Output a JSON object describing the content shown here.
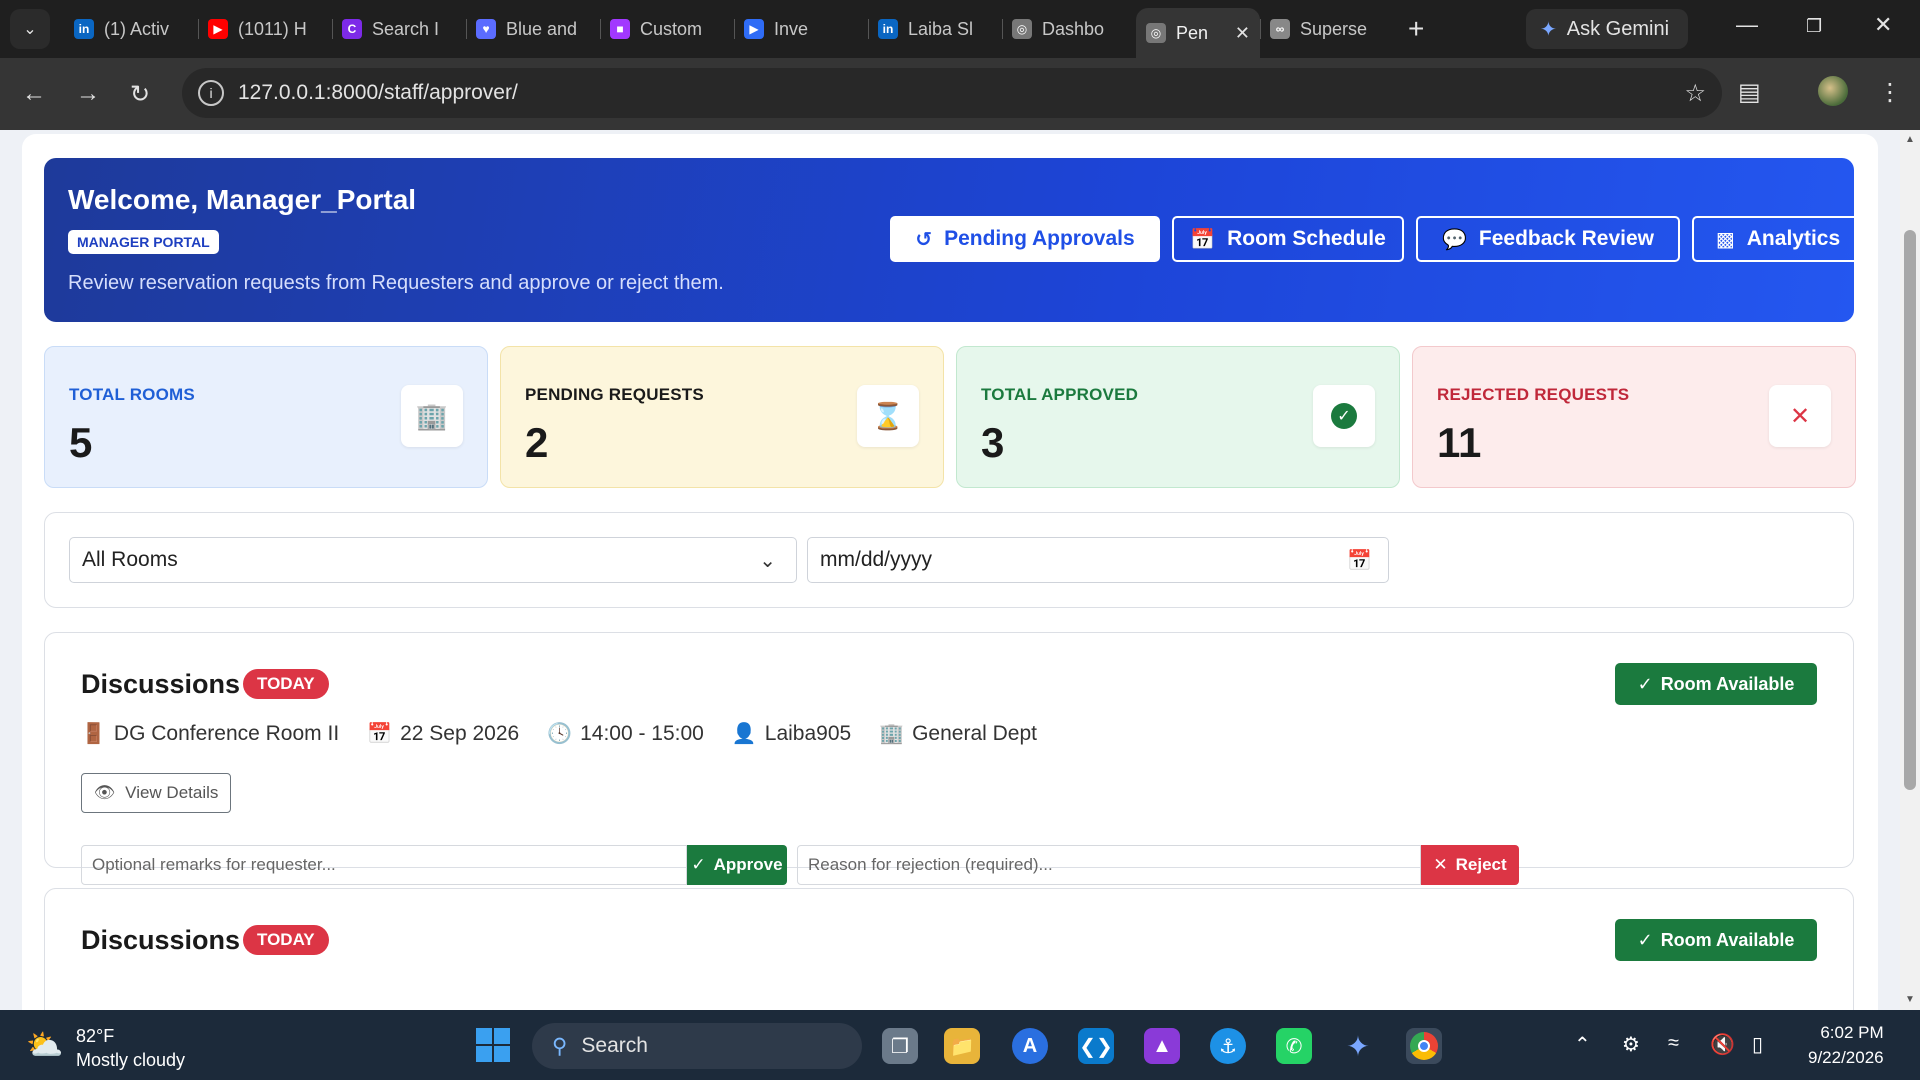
{
  "browser": {
    "tabs": [
      {
        "label": "(1) Activ",
        "favicon": "linkedin-icon",
        "color": "#0a66c2"
      },
      {
        "label": "(1011) H",
        "favicon": "youtube-icon",
        "color": "#ff0000"
      },
      {
        "label": "Search I",
        "favicon": "canva-icon",
        "color": "#7d2ae8"
      },
      {
        "label": "Blue and",
        "favicon": "heart-icon",
        "color": "#5b6cff"
      },
      {
        "label": "Custom",
        "favicon": "app-icon",
        "color": "#a238ff"
      },
      {
        "label": "Inve",
        "favicon": "play-icon",
        "color": "#2f6cf6"
      },
      {
        "label": "Laiba Sl",
        "favicon": "linkedin-icon",
        "color": "#0a66c2"
      },
      {
        "label": "Dashbo",
        "favicon": "globe-icon",
        "color": "#777777"
      },
      {
        "label": "Pen",
        "favicon": "globe-icon",
        "color": "#777777",
        "active": true
      },
      {
        "label": "Superse",
        "favicon": "infinity-icon",
        "color": "#888888"
      }
    ],
    "gemini_label": "Ask Gemini",
    "url": "127.0.0.1:8000/staff/approver/"
  },
  "hero": {
    "title": "Welcome, Manager_Portal",
    "badge": "MANAGER PORTAL",
    "subtitle": "Review reservation requests from Requesters and approve or reject them.",
    "buttons": {
      "pending": "Pending Approvals",
      "schedule": "Room Schedule",
      "feedback": "Feedback Review",
      "analytics": "Analytics"
    }
  },
  "stats": [
    {
      "label": "TOTAL ROOMS",
      "value": "5",
      "icon": "building-icon",
      "color": "#1f5fd6",
      "bg": "#e8f0fd",
      "border": "#c9dcf7"
    },
    {
      "label": "PENDING REQUESTS",
      "value": "2",
      "icon": "hourglass-icon",
      "color": "#1a1a1a",
      "bg": "#fdf6dc",
      "border": "#f3e3a8"
    },
    {
      "label": "TOTAL APPROVED",
      "value": "3",
      "icon": "check-circle-icon",
      "color": "#1b7a3e",
      "bg": "#e6f7ec",
      "border": "#c2e8cf"
    },
    {
      "label": "REJECTED REQUESTS",
      "value": "11",
      "icon": "x-icon",
      "color": "#c0283a",
      "bg": "#fdecec",
      "border": "#f3c9cc"
    }
  ],
  "filters": {
    "room_select": "All Rooms",
    "date_placeholder": "mm/dd/yyyy"
  },
  "requests": [
    {
      "title": "Discussions",
      "tag": "TODAY",
      "status": "Room Available",
      "room": "DG Conference Room II",
      "date": "22 Sep 2026",
      "time": "14:00 - 15:00",
      "user": "Laiba905",
      "dept": "General Dept",
      "view_details": "View Details",
      "remarks_placeholder": "Optional remarks for requester...",
      "approve": "Approve",
      "reject_placeholder": "Reason for rejection (required)...",
      "reject": "Reject"
    },
    {
      "title": "Discussions",
      "tag": "TODAY",
      "status": "Room Available"
    }
  ],
  "taskbar": {
    "temp": "82°F",
    "weather": "Mostly cloudy",
    "search": "Search",
    "time": "6:02 PM",
    "date": "9/22/2026"
  }
}
